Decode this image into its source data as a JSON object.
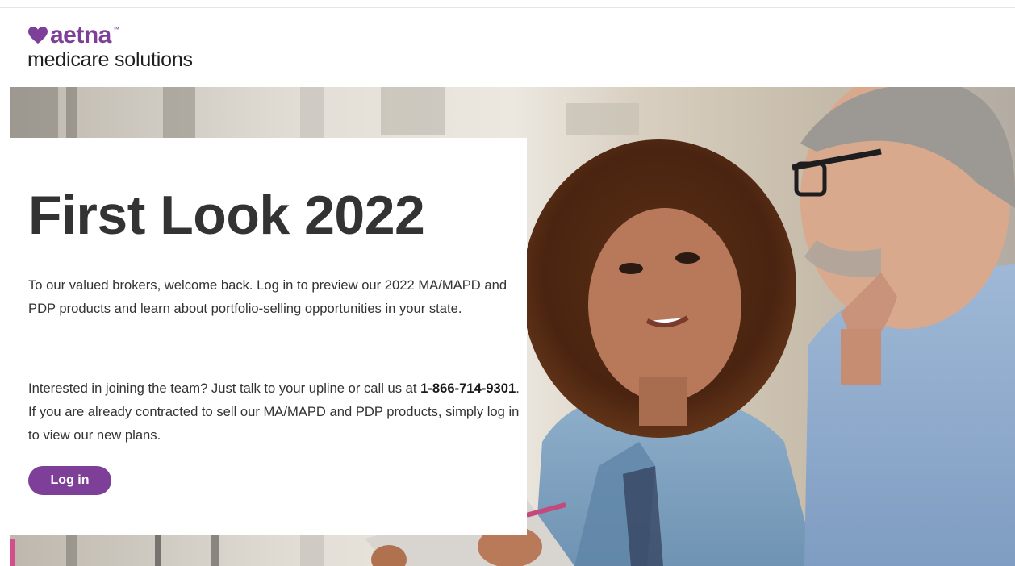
{
  "header": {
    "logo_brand": "aetna",
    "logo_trademark": "™",
    "logo_subtitle": "medicare solutions"
  },
  "hero": {
    "image_icon": "photo-woman-and-man-icon",
    "title": "First Look 2022",
    "paragraph1": "To our valued brokers, welcome back. Log in to preview our 2022 MA/MAPD and PDP products and learn about portfolio-selling opportunities in your state.",
    "paragraph2_before": "Interested in joining the team? Just talk to your upline or call us at ",
    "paragraph2_phone": "1-866-714-9301",
    "paragraph2_after": ". If you are already contracted to sell our MA/MAPD and PDP products, simply log in to view our new plans.",
    "login_label": "Log in"
  },
  "colors": {
    "brand_purple": "#7d3f98",
    "text": "#333333"
  }
}
